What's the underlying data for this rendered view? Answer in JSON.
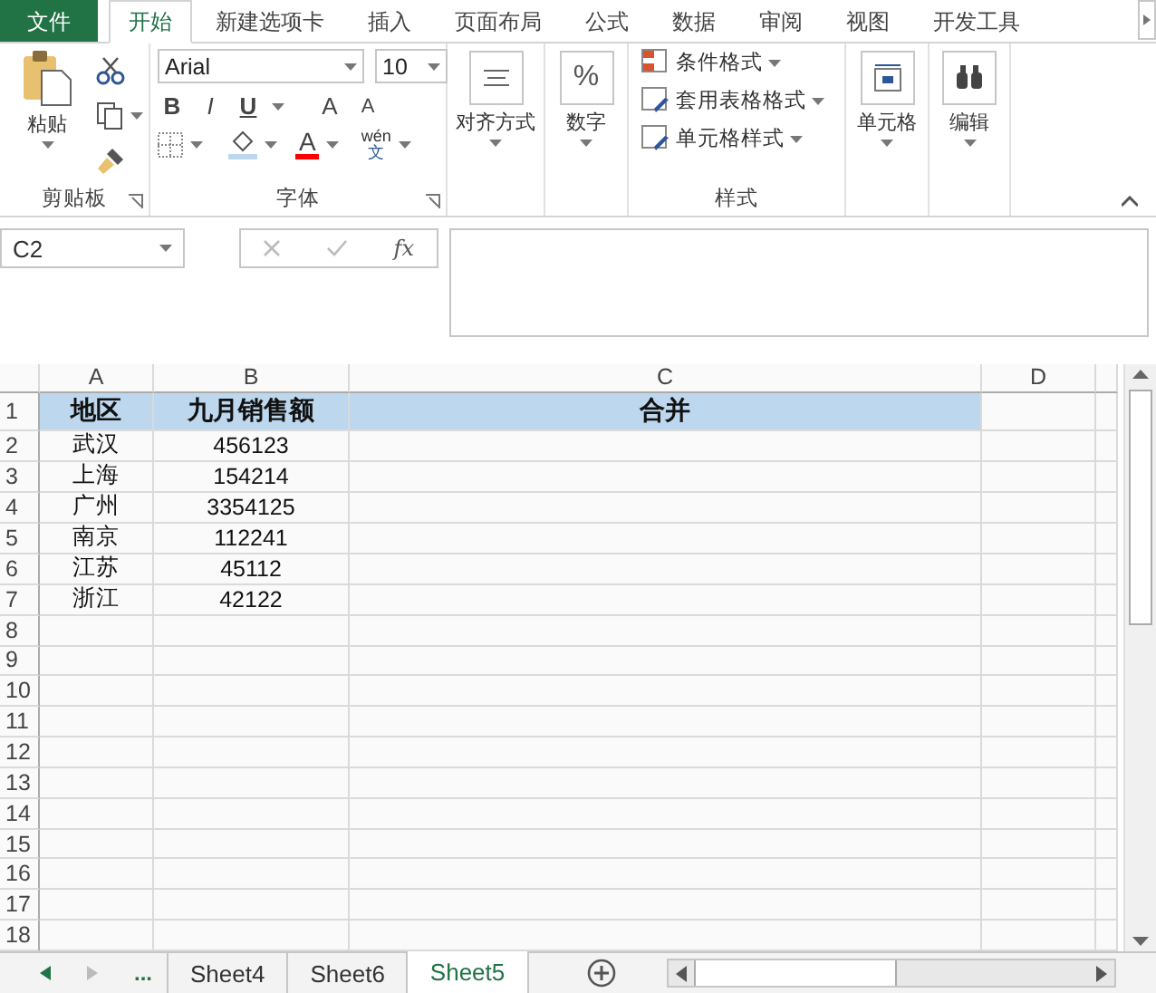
{
  "menu_tabs": [
    {
      "label": "文件",
      "kind": "file",
      "selected": false
    },
    {
      "label": "开始",
      "kind": "tab",
      "selected": true
    },
    {
      "label": "新建选项卡",
      "kind": "tab",
      "selected": false
    },
    {
      "label": "插入",
      "kind": "tab",
      "selected": false
    },
    {
      "label": "页面布局",
      "kind": "tab",
      "selected": false
    },
    {
      "label": "公式",
      "kind": "tab",
      "selected": false
    },
    {
      "label": "数据",
      "kind": "tab",
      "selected": false
    },
    {
      "label": "审阅",
      "kind": "tab",
      "selected": false
    },
    {
      "label": "视图",
      "kind": "tab",
      "selected": false
    },
    {
      "label": "开发工具",
      "kind": "tab",
      "selected": false
    }
  ],
  "ribbon": {
    "clipboard": {
      "paste": "粘贴",
      "label": "剪贴板"
    },
    "font": {
      "font_name": "Arial",
      "font_size": "10",
      "bold": "B",
      "italic": "I",
      "underline": "U",
      "grow": "A",
      "shrink": "A",
      "font_color": "A",
      "phonetic_top": "wén",
      "phonetic_bottom": "文",
      "label": "字体"
    },
    "alignment": {
      "label": "对齐方式"
    },
    "number": {
      "symbol": "%",
      "label": "数字"
    },
    "styles": {
      "items": [
        "条件格式",
        "套用表格格式",
        "单元格样式"
      ],
      "label": "样式"
    },
    "cells": {
      "label": "单元格"
    },
    "editing": {
      "label": "编辑"
    }
  },
  "formula_bar": {
    "name_box": "C2",
    "function": "fx"
  },
  "sheet": {
    "columns": [
      "A",
      "B",
      "C",
      "D"
    ],
    "rows": [
      {
        "number": "1",
        "kind": "header",
        "cells": [
          "地区",
          "九月销售额",
          "合并"
        ]
      },
      {
        "number": "2",
        "kind": "data",
        "cells": [
          "武汉",
          "456123"
        ]
      },
      {
        "number": "3",
        "kind": "data",
        "cells": [
          "上海",
          "154214"
        ]
      },
      {
        "number": "4",
        "kind": "data",
        "cells": [
          "广州",
          "3354125"
        ]
      },
      {
        "number": "5",
        "kind": "data",
        "cells": [
          "南京",
          "112241"
        ]
      },
      {
        "number": "6",
        "kind": "data",
        "cells": [
          "江苏",
          "45112"
        ]
      },
      {
        "number": "7",
        "kind": "data",
        "cells": [
          "浙江",
          "42122"
        ]
      },
      {
        "number": "8",
        "kind": "data",
        "cells": []
      },
      {
        "number": "9",
        "kind": "data",
        "cells": []
      },
      {
        "number": "10",
        "kind": "data",
        "cells": []
      },
      {
        "number": "11",
        "kind": "data",
        "cells": []
      },
      {
        "number": "12",
        "kind": "data",
        "cells": []
      },
      {
        "number": "13",
        "kind": "data",
        "cells": []
      },
      {
        "number": "14",
        "kind": "data",
        "cells": []
      },
      {
        "number": "15",
        "kind": "data",
        "cells": []
      },
      {
        "number": "16",
        "kind": "data",
        "cells": []
      },
      {
        "number": "17",
        "kind": "data",
        "cells": []
      },
      {
        "number": "18",
        "kind": "data",
        "cells": []
      }
    ]
  },
  "sheet_tabs": {
    "more": "...",
    "tabs": [
      {
        "label": "Sheet4",
        "selected": false
      },
      {
        "label": "Sheet6",
        "selected": false
      },
      {
        "label": "Sheet5",
        "selected": true
      }
    ]
  }
}
